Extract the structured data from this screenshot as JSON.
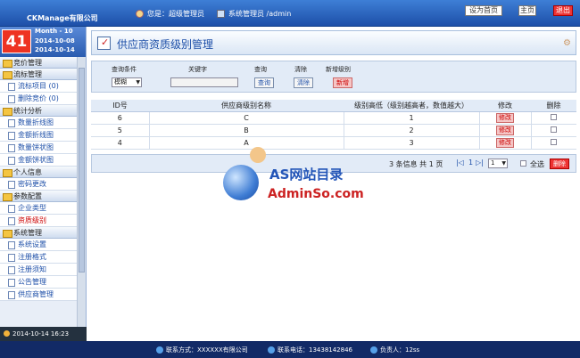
{
  "header": {
    "brand": "CKManage有限公司",
    "user_role": "您是：超级管理员",
    "user_name": "系统管理员 /admin",
    "set_home_label": "设为首页",
    "main_label": "主页",
    "logout_label": "退出"
  },
  "date_widget": {
    "day": "41",
    "month_label": "Month - 10",
    "date_start": "2014-10-08",
    "date_end": "2014-10-14"
  },
  "sidebar": {
    "groups": [
      {
        "label": "竞价管理",
        "items": []
      },
      {
        "label": "流标管理",
        "items": [
          {
            "label": "流标项目 (0)"
          },
          {
            "label": "删除竞价 (0)"
          }
        ]
      },
      {
        "label": "统计分析",
        "items": [
          {
            "label": "数量折线图"
          },
          {
            "label": "金额折线图"
          },
          {
            "label": "数量饼状图"
          },
          {
            "label": "金额饼状图"
          }
        ]
      },
      {
        "label": "个人信息",
        "items": [
          {
            "label": "密码更改"
          }
        ]
      },
      {
        "label": "参数配置",
        "items": [
          {
            "label": "企业类型"
          },
          {
            "label": "资质级别"
          }
        ]
      },
      {
        "label": "系统管理",
        "items": [
          {
            "label": "系统设置"
          },
          {
            "label": "注册格式"
          },
          {
            "label": "注册须知"
          },
          {
            "label": "公告管理"
          },
          {
            "label": "供应商管理"
          }
        ]
      }
    ],
    "active_item": "资质级别",
    "clock": "2014-10-14  16:23"
  },
  "page": {
    "title": "供应商资质级别管理"
  },
  "search": {
    "condition_label": "查询条件",
    "keyword_label": "关键字",
    "query_label": "查询",
    "clear_label": "清除",
    "add_label": "新增级别",
    "condition_value": "模糊",
    "keyword_value": "",
    "query_button": "查询",
    "clear_button": "清除",
    "add_button": "新增"
  },
  "table": {
    "headers": [
      "ID号",
      "供应商级别名称",
      "级别高低（级别越高者，数值越大）",
      "修改",
      "删除"
    ],
    "rows": [
      {
        "id": "6",
        "name": "C",
        "level": "1",
        "edit": "修改"
      },
      {
        "id": "5",
        "name": "B",
        "level": "2",
        "edit": "修改"
      },
      {
        "id": "4",
        "name": "A",
        "level": "3",
        "edit": "修改"
      }
    ]
  },
  "pager": {
    "summary": "3 条信息  共 1 页",
    "current_page": "1",
    "page_select": "1",
    "select_all_label": "全选",
    "delete_label": "删除"
  },
  "watermark": {
    "line1": "AS网站目录",
    "line2": "AdminSo.com"
  },
  "footer": {
    "contact": "联系方式：XXXXXX有限公司",
    "phone": "联系电话：13438142846",
    "person": "负责人：12ss"
  }
}
